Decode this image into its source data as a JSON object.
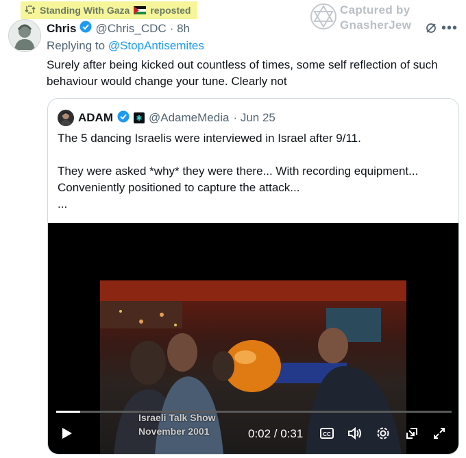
{
  "repost_banner": {
    "text": "Standing With Gaza",
    "suffix": "reposted"
  },
  "watermark": {
    "line1": "Captured by",
    "line2": "GnasherJew"
  },
  "tweet": {
    "name": "Chris",
    "handle": "@Chris_CDC",
    "time": "· 8h",
    "replying_prefix": "Replying to",
    "replying_to": "@StopAntisemites",
    "text": "Surely after being kicked out countless of times,  some self reflection of such behaviour would change your tune. Clearly not"
  },
  "quoted": {
    "name": "ADAM",
    "handle": "@AdameMedia",
    "date": "· Jun 25",
    "lines": [
      "The 5 dancing Israelis were interviewed in Israel after 9/11.",
      "",
      "They were asked *why* they were there... With recording equipment...",
      "Conveniently positioned to capture the attack...",
      "..."
    ]
  },
  "video": {
    "caption_line1": "Israeli Talk Show",
    "caption_line2": "November 2001",
    "time": "0:02 / 0:31",
    "progress_fraction": 0.06
  },
  "colors": {
    "accent": "#1d9bf0",
    "highlight": "#f6f59a"
  }
}
